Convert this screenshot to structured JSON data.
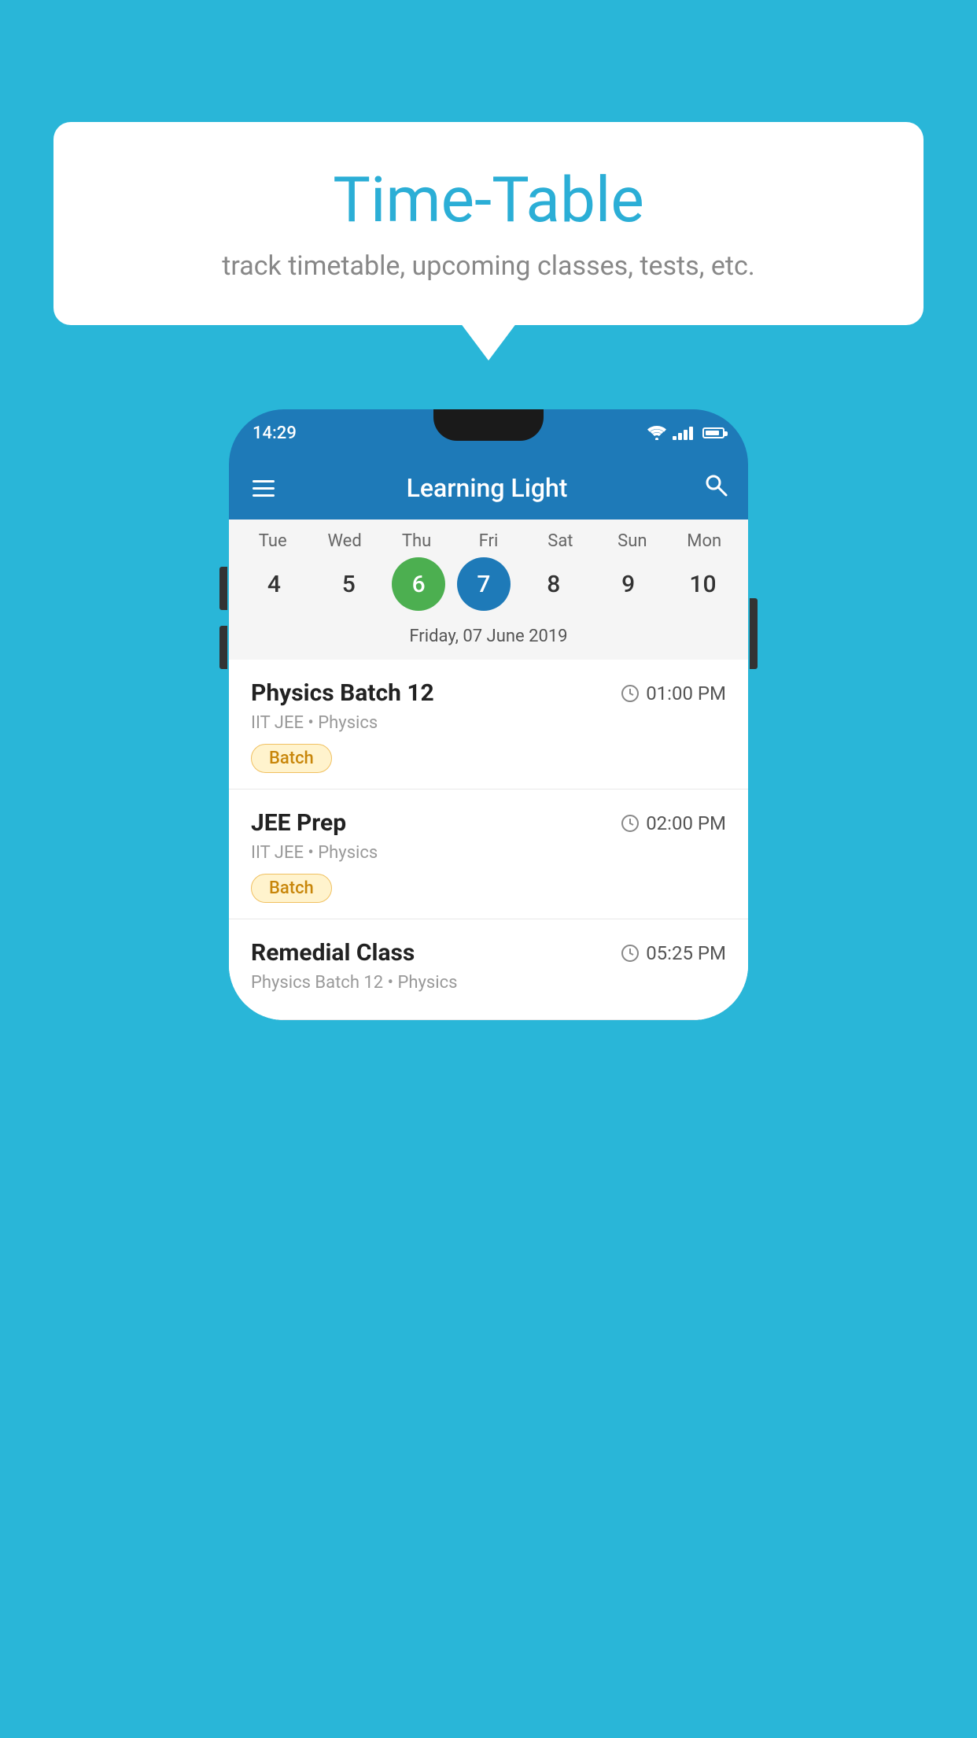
{
  "background_color": "#29b6d8",
  "speech_bubble": {
    "title": "Time-Table",
    "subtitle": "track timetable, upcoming classes, tests, etc."
  },
  "phone": {
    "status_bar": {
      "time": "14:29"
    },
    "toolbar": {
      "title": "Learning Light",
      "hamburger_label": "menu",
      "search_label": "search"
    },
    "calendar": {
      "days": [
        "Tue",
        "Wed",
        "Thu",
        "Fri",
        "Sat",
        "Sun",
        "Mon"
      ],
      "dates": [
        "4",
        "5",
        "6",
        "7",
        "8",
        "9",
        "10"
      ],
      "today_index": 2,
      "selected_index": 3,
      "selected_date_label": "Friday, 07 June 2019"
    },
    "schedule": [
      {
        "title": "Physics Batch 12",
        "time": "01:00 PM",
        "subtitle": "IIT JEE • Physics",
        "tag": "Batch"
      },
      {
        "title": "JEE Prep",
        "time": "02:00 PM",
        "subtitle": "IIT JEE • Physics",
        "tag": "Batch"
      },
      {
        "title": "Remedial Class",
        "time": "05:25 PM",
        "subtitle": "Physics Batch 12 • Physics",
        "tag": ""
      }
    ]
  }
}
